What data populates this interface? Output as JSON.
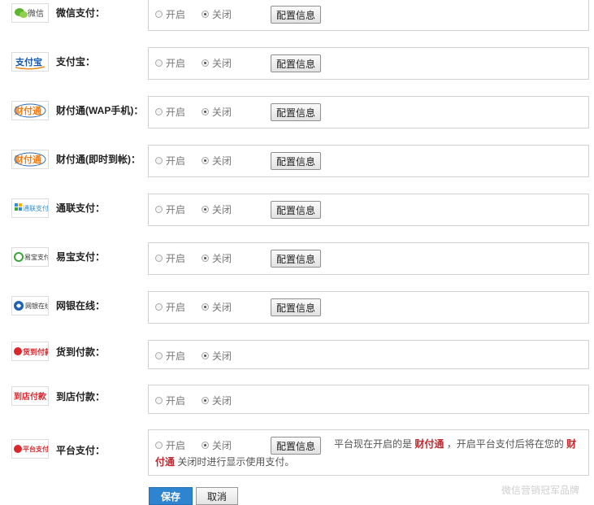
{
  "radio_on_label": "开启",
  "radio_off_label": "关闭",
  "config_button_label": "配置信息",
  "methods": [
    {
      "name": "微信支付：",
      "logo_text": "微信",
      "logo_icon": "wechat-logo-icon",
      "selected": "off",
      "has_config": true
    },
    {
      "name": "支付宝：",
      "logo_text": "支付宝",
      "logo_icon": "alipay-logo-icon",
      "selected": "off",
      "has_config": true
    },
    {
      "name": "财付通(WAP手机)：",
      "logo_text": "财付通",
      "logo_icon": "tenpay-logo-icon",
      "selected": "off",
      "has_config": true
    },
    {
      "name": "财付通(即时到帐)：",
      "logo_text": "财付通",
      "logo_icon": "tenpay-logo-icon",
      "selected": "off",
      "has_config": true
    },
    {
      "name": "通联支付：",
      "logo_text": "通联支付",
      "logo_icon": "allinpay-logo-icon",
      "selected": "off",
      "has_config": true
    },
    {
      "name": "易宝支付：",
      "logo_text": "易宝支付",
      "logo_icon": "yeepay-logo-icon",
      "selected": "off",
      "has_config": true
    },
    {
      "name": "网银在线：",
      "logo_text": "网银在线",
      "logo_icon": "chinabank-logo-icon",
      "selected": "off",
      "has_config": true
    },
    {
      "name": "货到付款：",
      "logo_text": "货到付款",
      "logo_icon": "cod-logo-icon",
      "selected": "off",
      "has_config": false
    },
    {
      "name": "到店付款：",
      "logo_text": "到店付款",
      "logo_icon": "store-pay-logo-icon",
      "selected": "off",
      "has_config": false
    },
    {
      "name": "平台支付：",
      "logo_text": "平台支付",
      "logo_icon": "platform-pay-logo-icon",
      "selected": "off",
      "has_config": true
    }
  ],
  "platform_note": {
    "prefix": "平台现在开启的是",
    "highlight1": "财付通",
    "middle": "，开启平台支付后将在您的",
    "highlight2": "财付通",
    "suffix": "关闭时进行显示使用支付。"
  },
  "save_label": "保存",
  "cancel_label": "取消",
  "watermark": "微信营销冠军品牌"
}
